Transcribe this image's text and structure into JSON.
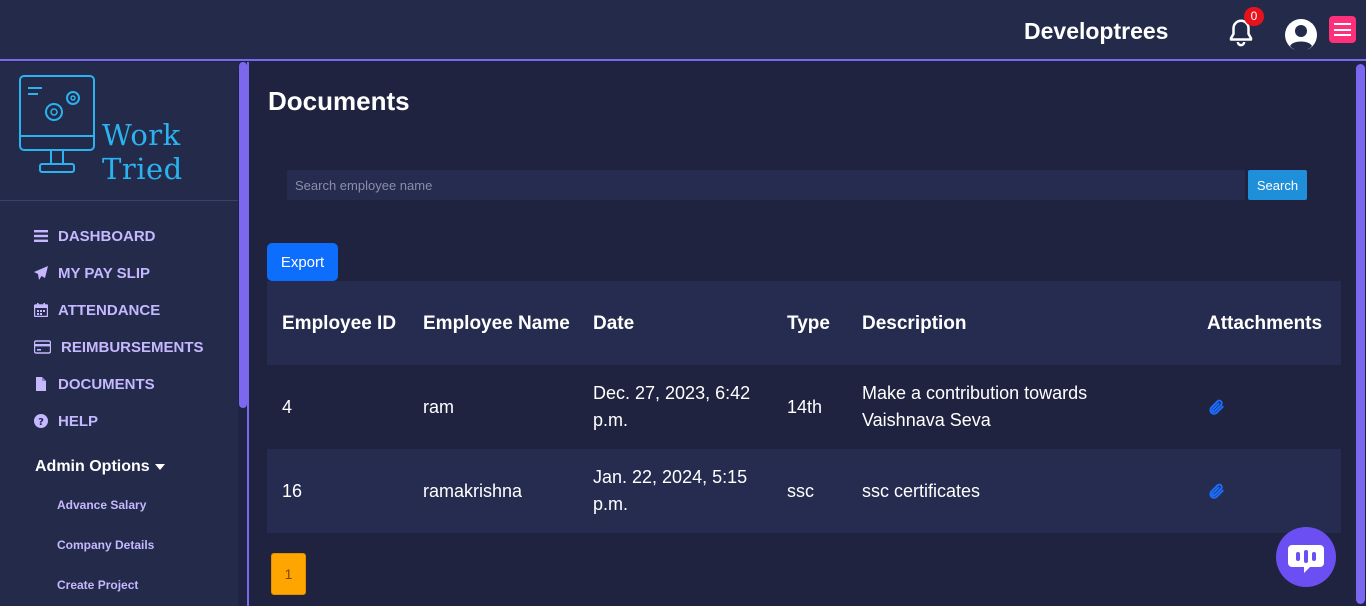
{
  "header": {
    "brand": "Developtrees",
    "notification_count": "0"
  },
  "sidebar": {
    "logo_text": "Work Tried",
    "nav": [
      {
        "label": "DASHBOARD",
        "icon": "bars-icon"
      },
      {
        "label": "MY PAY SLIP",
        "icon": "paper-plane-icon"
      },
      {
        "label": "ATTENDANCE",
        "icon": "calendar-icon"
      },
      {
        "label": "REIMBURSEMENTS",
        "icon": "credit-card-icon"
      },
      {
        "label": "DOCUMENTS",
        "icon": "file-icon"
      },
      {
        "label": "HELP",
        "icon": "question-circle-icon"
      }
    ],
    "admin_label": "Admin Options",
    "admin_items": [
      "Advance Salary",
      "Company Details",
      "Create Project"
    ]
  },
  "main": {
    "title": "Documents",
    "search_placeholder": "Search employee name",
    "search_button": "Search",
    "export_button": "Export",
    "columns": [
      "Employee ID",
      "Employee Name",
      "Date",
      "Type",
      "Description",
      "Attachments"
    ],
    "rows": [
      {
        "id": "4",
        "name": "ram",
        "date": "Dec. 27, 2023, 6:42 p.m.",
        "type": "14th",
        "description": "Make a contribution towards Vaishnava Seva"
      },
      {
        "id": "16",
        "name": "ramakrishna",
        "date": "Jan. 22, 2024, 5:15 p.m.",
        "type": "ssc",
        "description": "ssc certificates"
      }
    ],
    "pagination": [
      "1"
    ]
  },
  "colors": {
    "background": "#1f2340",
    "panel": "#232a4a",
    "accent": "#7b68ee",
    "nav_text": "#c5b8ff",
    "search_button": "#1e8fd8",
    "export_button": "#0d6efd",
    "active_page": "#ffa500",
    "badge": "#e8121d",
    "menu_button": "#ff2f7a"
  }
}
